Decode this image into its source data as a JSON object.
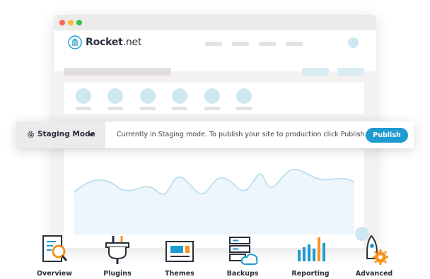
{
  "window": {
    "traffic_lights": [
      "#ff5f57",
      "#febc2e",
      "#28c840"
    ]
  },
  "app": {
    "brand_bold": "Rocket",
    "brand_thin": ".net"
  },
  "staging": {
    "mode_label": "Staging Mode",
    "message": "Currently in Staging mode. To publish your site to production click Publish.",
    "publish_label": "Publish"
  },
  "features": [
    {
      "label": "Overview",
      "icon": "magnifier-report-icon"
    },
    {
      "label": "Plugins",
      "icon": "plug-icon"
    },
    {
      "label": "Themes",
      "icon": "layout-window-icon"
    },
    {
      "label": "Backups",
      "icon": "server-cloud-icon"
    },
    {
      "label": "Reporting",
      "icon": "bar-chart-icon"
    },
    {
      "label": "Advanced",
      "icon": "rocket-gear-icon"
    }
  ],
  "colors": {
    "accent": "#1f9bd2",
    "orange": "#f7941d",
    "light_blue": "#cde8f3"
  }
}
